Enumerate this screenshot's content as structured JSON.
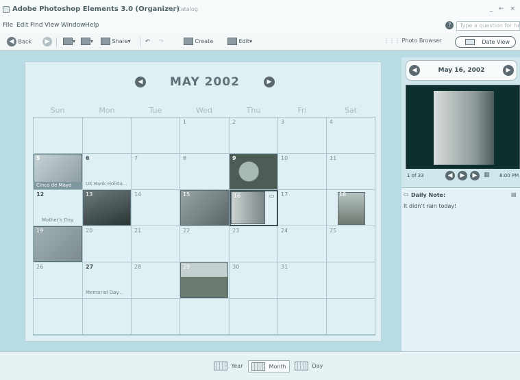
{
  "window": {
    "title": "Adobe Photoshop Elements 3.0 (Organizer)",
    "catalog": "My Catalog",
    "controls": "_ ← ×"
  },
  "menu": {
    "items": [
      "File",
      "Edit",
      "Find",
      "View",
      "Window",
      "Help"
    ],
    "question_placeholder": "Type a question for help"
  },
  "toolbar": {
    "back": "Back",
    "share": "Share",
    "create": "Create",
    "edit": "Edit",
    "photo_browser": "Photo Browser",
    "date_view": "Date View"
  },
  "calendar": {
    "month_title": "MAY 2002",
    "weekdays": [
      "Sun",
      "Mon",
      "Tue",
      "Wed",
      "Thu",
      "Fri",
      "Sat"
    ],
    "events": {
      "d5": "Cinco de Mayo",
      "d6": "UK Bank Holida...",
      "d12": "Mother's Day",
      "d27": "Memorial Day..."
    }
  },
  "side": {
    "date": "May 16, 2002",
    "counter": "1 of 33",
    "time": "8:00 PM",
    "note_label": "Daily Note:",
    "note_text": "It didn't rain today!"
  },
  "viewbar": {
    "year": "Year",
    "month": "Month",
    "day": "Day"
  },
  "colors": {
    "accent": "#5f7178",
    "background": "#b9dbe4",
    "panel": "#dff0f4"
  }
}
